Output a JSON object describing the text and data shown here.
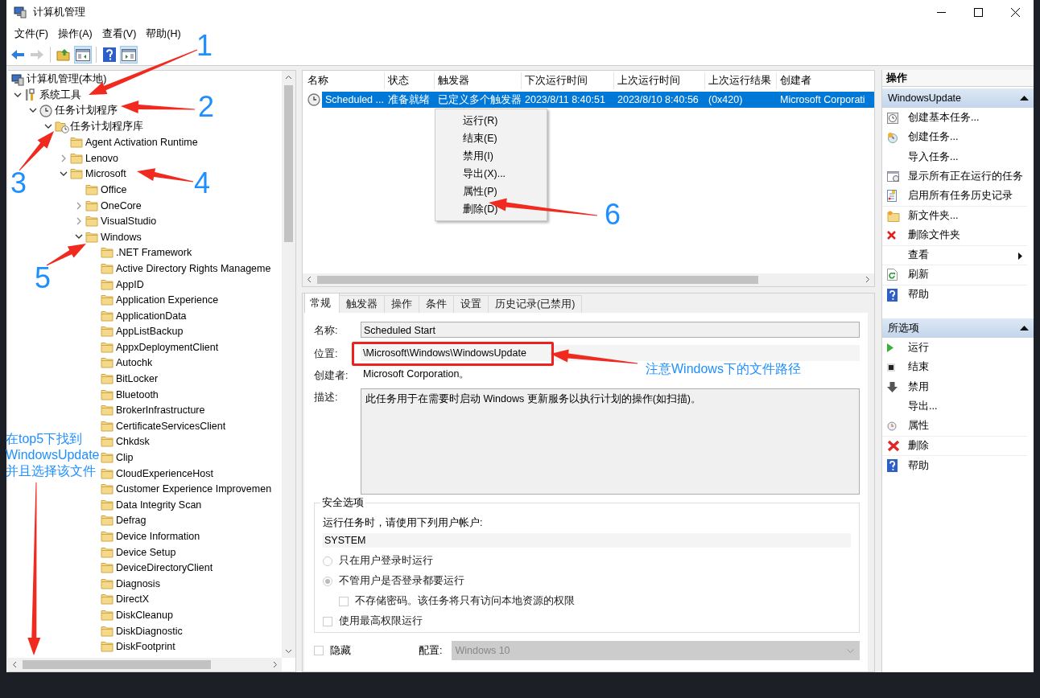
{
  "window": {
    "title": "计算机管理"
  },
  "menu": [
    "文件(F)",
    "操作(A)",
    "查看(V)",
    "帮助(H)"
  ],
  "toolbar": [
    {
      "kind": "back",
      "disabled": false,
      "pressed": false
    },
    {
      "kind": "forward",
      "disabled": true,
      "pressed": false
    },
    {
      "kind": "up_folder",
      "disabled": false,
      "pressed": false
    },
    {
      "kind": "console_tree",
      "disabled": false,
      "pressed": true
    },
    {
      "kind": "help",
      "disabled": false,
      "pressed": false
    },
    {
      "kind": "action_pane",
      "disabled": false,
      "pressed": true
    }
  ],
  "tree": {
    "label": "计算机管理(本地)",
    "kind": "computer",
    "children": [
      {
        "label": "系统工具",
        "kind": "tools",
        "expanded": true,
        "children": [
          {
            "label": "任务计划程序",
            "kind": "scheduler",
            "expanded": true,
            "children": [
              {
                "label": "任务计划程序库",
                "kind": "library",
                "expanded": true,
                "children": [
                  {
                    "label": "Agent Activation Runtime",
                    "kind": "folder"
                  },
                  {
                    "label": "Lenovo",
                    "kind": "folder",
                    "expanded": false
                  },
                  {
                    "label": "Microsoft",
                    "kind": "folder",
                    "expanded": true,
                    "children": [
                      {
                        "label": "Office",
                        "kind": "folder"
                      },
                      {
                        "label": "OneCore",
                        "kind": "folder",
                        "expanded": false
                      },
                      {
                        "label": "VisualStudio",
                        "kind": "folder",
                        "expanded": false
                      },
                      {
                        "label": "Windows",
                        "kind": "folder",
                        "expanded": true,
                        "children": [
                          {
                            "label": ".NET Framework",
                            "kind": "folder"
                          },
                          {
                            "label": "Active Directory Rights Manageme",
                            "kind": "folder"
                          },
                          {
                            "label": "AppID",
                            "kind": "folder"
                          },
                          {
                            "label": "Application Experience",
                            "kind": "folder"
                          },
                          {
                            "label": "ApplicationData",
                            "kind": "folder"
                          },
                          {
                            "label": "AppListBackup",
                            "kind": "folder"
                          },
                          {
                            "label": "AppxDeploymentClient",
                            "kind": "folder"
                          },
                          {
                            "label": "Autochk",
                            "kind": "folder"
                          },
                          {
                            "label": "BitLocker",
                            "kind": "folder"
                          },
                          {
                            "label": "Bluetooth",
                            "kind": "folder"
                          },
                          {
                            "label": "BrokerInfrastructure",
                            "kind": "folder"
                          },
                          {
                            "label": "CertificateServicesClient",
                            "kind": "folder"
                          },
                          {
                            "label": "Chkdsk",
                            "kind": "folder"
                          },
                          {
                            "label": "Clip",
                            "kind": "folder"
                          },
                          {
                            "label": "CloudExperienceHost",
                            "kind": "folder"
                          },
                          {
                            "label": "Customer Experience Improvemen",
                            "kind": "folder"
                          },
                          {
                            "label": "Data Integrity Scan",
                            "kind": "folder"
                          },
                          {
                            "label": "Defrag",
                            "kind": "folder"
                          },
                          {
                            "label": "Device Information",
                            "kind": "folder"
                          },
                          {
                            "label": "Device Setup",
                            "kind": "folder"
                          },
                          {
                            "label": "DeviceDirectoryClient",
                            "kind": "folder"
                          },
                          {
                            "label": "Diagnosis",
                            "kind": "folder"
                          },
                          {
                            "label": "DirectX",
                            "kind": "folder"
                          },
                          {
                            "label": "DiskCleanup",
                            "kind": "folder"
                          },
                          {
                            "label": "DiskDiagnostic",
                            "kind": "folder"
                          },
                          {
                            "label": "DiskFootprint",
                            "kind": "folder"
                          }
                        ]
                      }
                    ]
                  }
                ]
              }
            ]
          }
        ]
      }
    ]
  },
  "task_list": {
    "columns": [
      "名称",
      "状态",
      "触发器",
      "下次运行时间",
      "上次运行时间",
      "上次运行结果",
      "创建者"
    ],
    "rows": [
      {
        "selected": true,
        "cells": [
          "Scheduled ...",
          "准备就绪",
          "已定义多个触发器",
          "2023/8/11 8:40:51",
          "2023/8/10 8:40:56",
          "(0x420)",
          "Microsoft Corporati"
        ]
      }
    ]
  },
  "context_menu": {
    "items": [
      "运行(R)",
      "结束(E)",
      "禁用(I)",
      "导出(X)...",
      "属性(P)",
      "删除(D)"
    ]
  },
  "details": {
    "tabs": [
      {
        "label": "常规",
        "selected": true
      },
      {
        "label": "触发器",
        "selected": false
      },
      {
        "label": "操作",
        "selected": false
      },
      {
        "label": "条件",
        "selected": false
      },
      {
        "label": "设置",
        "selected": false
      },
      {
        "label": "历史记录(已禁用)",
        "selected": false
      }
    ],
    "fields": [
      {
        "kind": "box",
        "label": "名称:",
        "value": "Scheduled Start"
      },
      {
        "kind": "plain",
        "label": "位置:",
        "value": "\\Microsoft\\Windows\\WindowsUpdate"
      },
      {
        "kind": "text",
        "label": "创建者:",
        "value": "Microsoft Corporation。"
      },
      {
        "kind": "area",
        "label": "描述:",
        "value": "此任务用于在需要时启动 Windows 更新服务以执行计划的操作(如扫描)。"
      }
    ],
    "security": {
      "title": "安全选项",
      "prompt": "运行任务时，请使用下列用户帐户:",
      "account": "SYSTEM",
      "options": [
        {
          "kind": "radio",
          "label": "只在用户登录时运行",
          "selected": false
        },
        {
          "kind": "radio",
          "label": "不管用户是否登录都要运行",
          "selected": true,
          "children": [
            {
              "kind": "checkbox",
              "label": "不存储密码。该任务将只有访问本地资源的权限",
              "checked": false
            }
          ]
        },
        {
          "kind": "checkbox",
          "label": "使用最高权限运行",
          "checked": false
        }
      ]
    },
    "hidden": {
      "label": "隐藏",
      "checked": false
    },
    "config": {
      "label": "配置:",
      "value": "Windows 10"
    }
  },
  "actions": {
    "title": "操作",
    "sections": [
      {
        "title": "WindowsUpdate",
        "expanded": true,
        "items": [
          {
            "label": "创建基本任务...",
            "submenu": false,
            "divider_after": false
          },
          {
            "label": "创建任务...",
            "submenu": false,
            "divider_after": false
          },
          {
            "label": "导入任务...",
            "submenu": false,
            "divider_after": false
          },
          {
            "label": "显示所有正在运行的任务",
            "submenu": false,
            "divider_after": false
          },
          {
            "label": "启用所有任务历史记录",
            "submenu": false,
            "divider_after": true
          },
          {
            "label": "新文件夹...",
            "submenu": false,
            "divider_after": false
          },
          {
            "label": "删除文件夹",
            "submenu": false,
            "divider_after": true
          },
          {
            "label": "查看",
            "submenu": true,
            "divider_after": true
          },
          {
            "label": "刷新",
            "submenu": false,
            "divider_after": true
          },
          {
            "label": "帮助",
            "submenu": false,
            "divider_after": false
          }
        ]
      },
      {
        "title": "所选项",
        "expanded": true,
        "items": [
          {
            "label": "运行",
            "submenu": false,
            "divider_after": false
          },
          {
            "label": "结束",
            "submenu": false,
            "divider_after": false
          },
          {
            "label": "禁用",
            "submenu": false,
            "divider_after": false
          },
          {
            "label": "导出...",
            "submenu": false,
            "divider_after": false
          },
          {
            "label": "属性",
            "submenu": false,
            "divider_after": true
          },
          {
            "label": "删除",
            "submenu": false,
            "divider_after": true
          },
          {
            "label": "帮助",
            "submenu": false,
            "divider_after": false
          }
        ]
      }
    ]
  },
  "annotations": {
    "step_numbers": [
      "1",
      "2",
      "3",
      "4",
      "5",
      "6"
    ],
    "notes": [
      "注意Windows下的文件路径",
      "在top5下找到\nWindowsUpdate\n并且选择该文件"
    ]
  }
}
